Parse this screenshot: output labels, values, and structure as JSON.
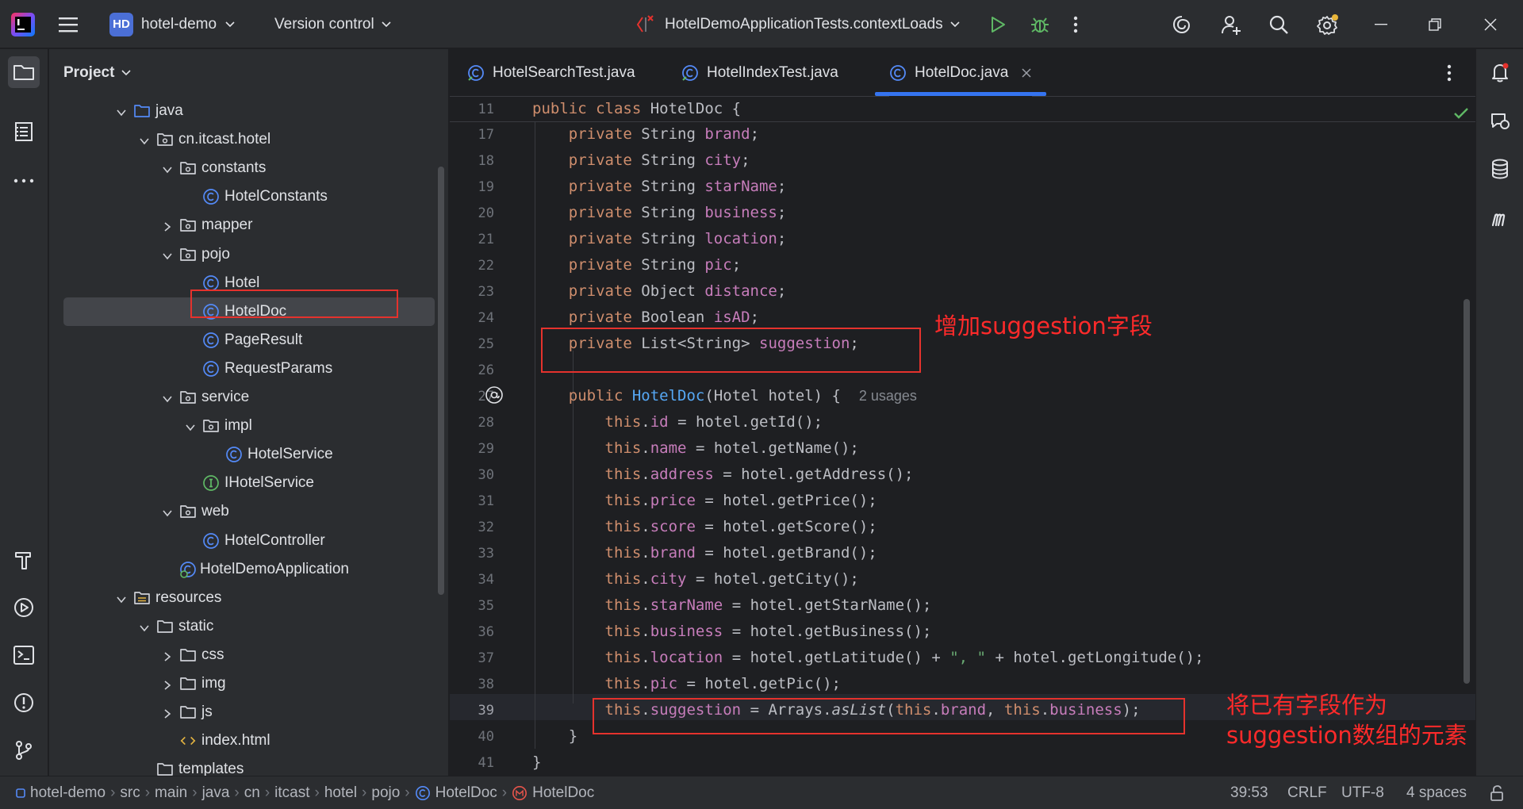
{
  "titlebar": {
    "project_badge": "HD",
    "project_name": "hotel-demo",
    "vcs_label": "Version control",
    "run_config": "HotelDemoApplicationTests.contextLoads"
  },
  "project_panel": {
    "title": "Project",
    "tree": [
      {
        "label": "java",
        "icon": "source-folder-icon",
        "chevron": "open"
      },
      {
        "label": "cn.itcast.hotel",
        "icon": "package-icon",
        "chevron": "open"
      },
      {
        "label": "constants",
        "icon": "package-icon",
        "chevron": "open"
      },
      {
        "label": "HotelConstants",
        "icon": "class-icon",
        "chevron": "none"
      },
      {
        "label": "mapper",
        "icon": "package-icon",
        "chevron": "closed"
      },
      {
        "label": "pojo",
        "icon": "package-icon",
        "chevron": "open"
      },
      {
        "label": "Hotel",
        "icon": "class-icon",
        "chevron": "none"
      },
      {
        "label": "HotelDoc",
        "icon": "class-icon",
        "chevron": "none"
      },
      {
        "label": "PageResult",
        "icon": "class-icon",
        "chevron": "none"
      },
      {
        "label": "RequestParams",
        "icon": "class-icon",
        "chevron": "none"
      },
      {
        "label": "service",
        "icon": "package-icon",
        "chevron": "open"
      },
      {
        "label": "impl",
        "icon": "package-icon",
        "chevron": "open"
      },
      {
        "label": "HotelService",
        "icon": "class-icon",
        "chevron": "none"
      },
      {
        "label": "IHotelService",
        "icon": "interface-icon",
        "chevron": "none"
      },
      {
        "label": "web",
        "icon": "package-icon",
        "chevron": "open"
      },
      {
        "label": "HotelController",
        "icon": "class-icon",
        "chevron": "none"
      },
      {
        "label": "HotelDemoApplication",
        "icon": "spring-boot-icon",
        "chevron": "none"
      },
      {
        "label": "resources",
        "icon": "resources-folder-icon",
        "chevron": "open"
      },
      {
        "label": "static",
        "icon": "folder-icon",
        "chevron": "open"
      },
      {
        "label": "css",
        "icon": "folder-icon",
        "chevron": "closed"
      },
      {
        "label": "img",
        "icon": "folder-icon",
        "chevron": "closed"
      },
      {
        "label": "js",
        "icon": "folder-icon",
        "chevron": "closed"
      },
      {
        "label": "index.html",
        "icon": "html-icon",
        "chevron": "none"
      },
      {
        "label": "templates",
        "icon": "folder-icon",
        "chevron": "none"
      }
    ],
    "selected": "HotelDoc"
  },
  "tabs": [
    {
      "label": "HotelSearchTest.java",
      "active": false
    },
    {
      "label": "HotelIndexTest.java",
      "active": false
    },
    {
      "label": "HotelDoc.java",
      "active": true
    }
  ],
  "editor": {
    "sticky_line": "11",
    "sticky_code": "public class HotelDoc {",
    "line_numbers": [
      "17",
      "18",
      "19",
      "20",
      "21",
      "22",
      "23",
      "24",
      "25",
      "26",
      "27",
      "28",
      "29",
      "30",
      "31",
      "32",
      "33",
      "34",
      "35",
      "36",
      "37",
      "38",
      "39",
      "40",
      "41"
    ],
    "usages_hint": "2 usages",
    "current_line": "39"
  },
  "annotations": {
    "field_note": "增加suggestion字段",
    "element_note_line1": "将已有字段作为",
    "element_note_line2": "suggestion数组的元素"
  },
  "statusbar": {
    "breadcrumbs": [
      "hotel-demo",
      "src",
      "main",
      "java",
      "cn",
      "itcast",
      "hotel",
      "pojo",
      "HotelDoc",
      "HotelDoc"
    ],
    "position": "39:53",
    "line_sep": "CRLF",
    "encoding": "UTF-8",
    "indent": "4 spaces"
  },
  "colors": {
    "keyword": "#cf8e6d",
    "field": "#c77dbb",
    "method_decl": "#56a8f5",
    "string": "#6aab73",
    "annotation_red": "#e5322d",
    "accent": "#3574f0"
  }
}
